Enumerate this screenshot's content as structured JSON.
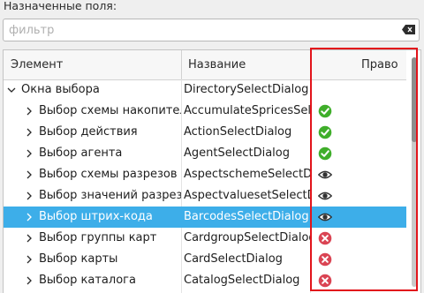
{
  "panel": {
    "title": "Назначенные поля:"
  },
  "filter": {
    "placeholder": "фильтр",
    "clear_icon": "clear-left-icon"
  },
  "columns": {
    "element": "Элемент",
    "name": "Название",
    "right": "Право"
  },
  "rows": [
    {
      "element": "Окна выбора",
      "name": "DirectorySelectDialog",
      "level": 0,
      "expanded": true,
      "right": "",
      "selected": false
    },
    {
      "element": "Выбор схемы накопител",
      "name": "AccumulateSpricesSele",
      "level": 1,
      "expanded": false,
      "right": "check",
      "selected": false
    },
    {
      "element": "Выбор действия",
      "name": "ActionSelectDialog",
      "level": 1,
      "expanded": false,
      "right": "check",
      "selected": false
    },
    {
      "element": "Выбор агента",
      "name": "AgentSelectDialog",
      "level": 1,
      "expanded": false,
      "right": "check",
      "selected": false
    },
    {
      "element": "Выбор схемы разрезов",
      "name": "AspectschemeSelectDia",
      "level": 1,
      "expanded": false,
      "right": "eye",
      "selected": false
    },
    {
      "element": "Выбор значений разрез",
      "name": "AspectvaluesetSelectD",
      "level": 1,
      "expanded": false,
      "right": "eye",
      "selected": false
    },
    {
      "element": "Выбор штрих-кода",
      "name": "BarcodesSelectDialog",
      "level": 1,
      "expanded": false,
      "right": "eye",
      "selected": true
    },
    {
      "element": "Выбор группы карт",
      "name": "CardgroupSelectDialog",
      "level": 1,
      "expanded": false,
      "right": "deny",
      "selected": false
    },
    {
      "element": "Выбор карты",
      "name": "CardSelectDialog",
      "level": 1,
      "expanded": false,
      "right": "deny",
      "selected": false
    },
    {
      "element": "Выбор каталога",
      "name": "CatalogSelectDialog",
      "level": 1,
      "expanded": false,
      "right": "deny",
      "selected": false
    }
  ],
  "colors": {
    "selection": "#3daee9",
    "check": "#3fae2a",
    "deny": "#da4453",
    "highlight": "#e2141b"
  }
}
